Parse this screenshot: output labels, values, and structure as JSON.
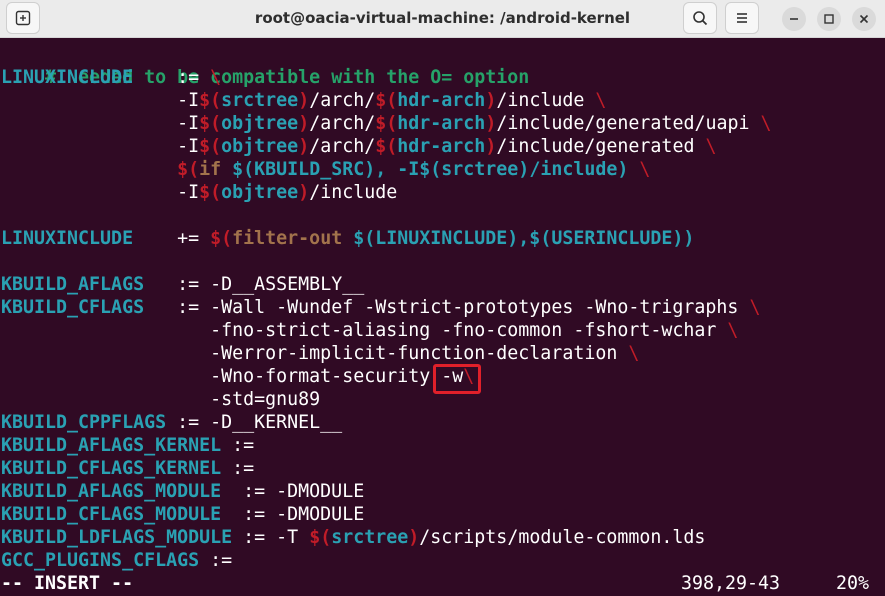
{
  "window": {
    "title": "root@oacia-virtual-machine: /android-kernel",
    "buttons": [
      "new-tab",
      "search",
      "menu",
      "minimize",
      "maximize",
      "close"
    ]
  },
  "editor": {
    "lines": {
      "l0": "# Needed to be compatible with the O= option",
      "l1a": "LINUXINCLUDE",
      "l1b": "    := ",
      "l1c": "\\",
      "l2a": "                -I",
      "l2b": "$(",
      "l2c": "srctree",
      "l2d": ")",
      "l2e": "/arch/",
      "l2f": "$(",
      "l2g": "hdr-arch",
      "l2h": ")",
      "l2i": "/include ",
      "l2j": "\\",
      "l3a": "                -I",
      "l3b": "$(",
      "l3c": "objtree",
      "l3d": ")",
      "l3e": "/arch/",
      "l3f": "$(",
      "l3g": "hdr-arch",
      "l3h": ")",
      "l3i": "/include/generated/uapi ",
      "l3j": "\\",
      "l4a": "                -I",
      "l4b": "$(",
      "l4c": "objtree",
      "l4d": ")",
      "l4e": "/arch/",
      "l4f": "$(",
      "l4g": "hdr-arch",
      "l4h": ")",
      "l4i": "/include/generated ",
      "l4j": "\\",
      "l5a": "                ",
      "l5b": "$(",
      "l5c": "if",
      "l5d": " $(KBUILD_SRC), -I$(srctree)/include) ",
      "l5e": "\\",
      "l6a": "                -I",
      "l6b": "$(",
      "l6c": "objtree",
      "l6d": ")",
      "l6e": "/include",
      "l8a": "LINUXINCLUDE",
      "l8b": "    += ",
      "l8c": "$(",
      "l8d": "filter-out",
      "l8e": " $(LINUXINCLUDE),$(USERINCLUDE))",
      "l10a": "KBUILD_AFLAGS",
      "l10b": "   := -D__ASSEMBLY__",
      "l11a": "KBUILD_CFLAGS",
      "l11b": "   := -Wall -Wundef -Wstrict-prototypes -Wno-trigraphs ",
      "l11c": "\\",
      "l12a": "                   -fno-strict-aliasing -fno-common -fshort-wchar ",
      "l12b": "\\",
      "l13a": "                   -Werror-implicit-function-declaration ",
      "l13b": "\\",
      "l14a": "                   -Wno-format-security ",
      "l14b": "-w",
      "l14c": "\\",
      "l15a": "                   -std=gnu89",
      "l16a": "KBUILD_CPPFLAGS",
      "l16b": " := -D__KERNEL__",
      "l17a": "KBUILD_AFLAGS_KERNEL",
      "l17b": " :=",
      "l18a": "KBUILD_CFLAGS_KERNEL",
      "l18b": " :=",
      "l19a": "KBUILD_AFLAGS_MODULE",
      "l19b": "  := -DMODULE",
      "l20a": "KBUILD_CFLAGS_MODULE",
      "l20b": "  := -DMODULE",
      "l21a": "KBUILD_LDFLAGS_MODULE",
      "l21b": " := -T ",
      "l21c": "$(",
      "l21d": "srctree",
      "l21e": ")",
      "l21f": "/scripts/module-common.lds",
      "l22a": "GCC_PLUGINS_CFLAGS",
      "l22b": " :="
    },
    "status": {
      "mode": "-- INSERT --",
      "position": "398,29-43",
      "percent": "20%"
    }
  }
}
